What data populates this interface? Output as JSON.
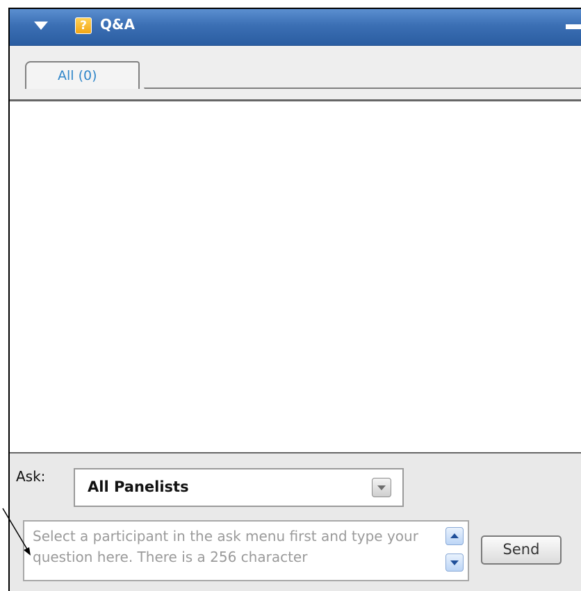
{
  "panel": {
    "title": "Q&A",
    "help_glyph": "?",
    "icons": {
      "collapse": "triangle-down-icon",
      "help": "help-icon",
      "minimize": "minimize-icon"
    },
    "accent_color": "#3b6fb4"
  },
  "tabs": [
    {
      "label": "All (0)",
      "selected": true
    }
  ],
  "ask": {
    "label": "Ask:",
    "selected_value": "All Panelists"
  },
  "question": {
    "placeholder": "Select a participant in the ask menu first and type your question here. There is a 256 character"
  },
  "send": {
    "label": "Send"
  }
}
